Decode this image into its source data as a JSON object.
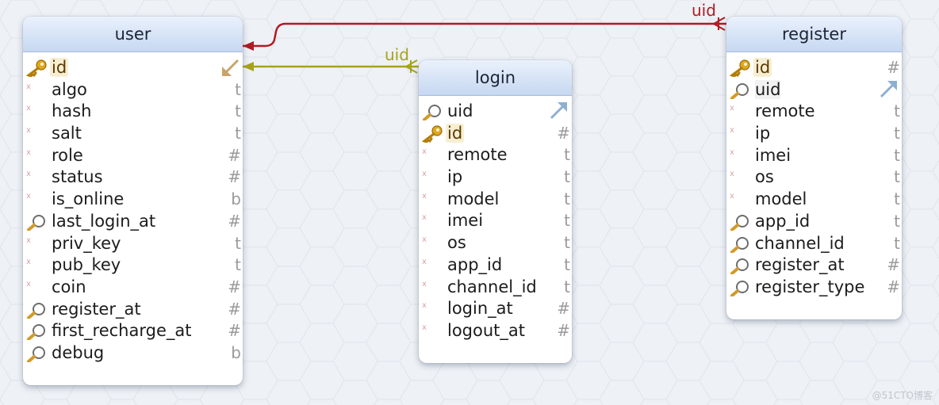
{
  "tables": [
    {
      "id": "user",
      "title": "user",
      "columns": [
        {
          "name": "id",
          "type": "",
          "icon": "key",
          "marker": "x",
          "rel": "incoming"
        },
        {
          "name": "algo",
          "type": "t",
          "icon": "none",
          "marker": "x"
        },
        {
          "name": "hash",
          "type": "t",
          "icon": "none",
          "marker": "x"
        },
        {
          "name": "salt",
          "type": "t",
          "icon": "none",
          "marker": "x"
        },
        {
          "name": "role",
          "type": "#",
          "icon": "none",
          "marker": "x"
        },
        {
          "name": "status",
          "type": "#",
          "icon": "none",
          "marker": "x"
        },
        {
          "name": "is_online",
          "type": "b",
          "icon": "none",
          "marker": "x"
        },
        {
          "name": "last_login_at",
          "type": "#",
          "icon": "index",
          "marker": "x"
        },
        {
          "name": "priv_key",
          "type": "t",
          "icon": "none",
          "marker": "x"
        },
        {
          "name": "pub_key",
          "type": "t",
          "icon": "none",
          "marker": "x"
        },
        {
          "name": "coin",
          "type": "#",
          "icon": "none",
          "marker": "x"
        },
        {
          "name": "register_at",
          "type": "#",
          "icon": "index",
          "marker": "x"
        },
        {
          "name": "first_recharge_at",
          "type": "#",
          "icon": "index",
          "marker": "x"
        },
        {
          "name": "debug",
          "type": "b",
          "icon": "index",
          "marker": "x"
        }
      ]
    },
    {
      "id": "login",
      "title": "login",
      "columns": [
        {
          "name": "uid",
          "type": "",
          "icon": "index",
          "marker": "x",
          "rel": "outgoing"
        },
        {
          "name": "id",
          "type": "#",
          "icon": "key",
          "marker": "x"
        },
        {
          "name": "remote",
          "type": "t",
          "icon": "none",
          "marker": "x"
        },
        {
          "name": "ip",
          "type": "t",
          "icon": "none",
          "marker": "x"
        },
        {
          "name": "model",
          "type": "t",
          "icon": "none",
          "marker": "x"
        },
        {
          "name": "imei",
          "type": "t",
          "icon": "none",
          "marker": "x"
        },
        {
          "name": "os",
          "type": "t",
          "icon": "none",
          "marker": "x"
        },
        {
          "name": "app_id",
          "type": "t",
          "icon": "none",
          "marker": "x"
        },
        {
          "name": "channel_id",
          "type": "t",
          "icon": "none",
          "marker": "x"
        },
        {
          "name": "login_at",
          "type": "#",
          "icon": "none",
          "marker": "x"
        },
        {
          "name": "logout_at",
          "type": "#",
          "icon": "none",
          "marker": "x"
        }
      ]
    },
    {
      "id": "register",
      "title": "register",
      "columns": [
        {
          "name": "id",
          "type": "#",
          "icon": "key",
          "marker": "x"
        },
        {
          "name": "uid",
          "type": "",
          "icon": "index",
          "marker": "x",
          "rel": "outgoing"
        },
        {
          "name": "remote",
          "type": "t",
          "icon": "none",
          "marker": "x"
        },
        {
          "name": "ip",
          "type": "t",
          "icon": "none",
          "marker": "x"
        },
        {
          "name": "imei",
          "type": "t",
          "icon": "none",
          "marker": "x"
        },
        {
          "name": "os",
          "type": "t",
          "icon": "none",
          "marker": "x"
        },
        {
          "name": "model",
          "type": "t",
          "icon": "none",
          "marker": "x"
        },
        {
          "name": "app_id",
          "type": "t",
          "icon": "index",
          "marker": "x"
        },
        {
          "name": "channel_id",
          "type": "t",
          "icon": "index",
          "marker": "x"
        },
        {
          "name": "register_at",
          "type": "#",
          "icon": "index",
          "marker": "x"
        },
        {
          "name": "register_type",
          "type": "#",
          "icon": "index",
          "marker": "x"
        }
      ]
    }
  ],
  "relations": [
    {
      "from": "register",
      "to": "user",
      "label": "uid",
      "color": "#b01b22"
    },
    {
      "from": "login",
      "to": "user",
      "label": "uid",
      "color": "#a7a21a"
    }
  ],
  "watermark": "@51CTO博客"
}
